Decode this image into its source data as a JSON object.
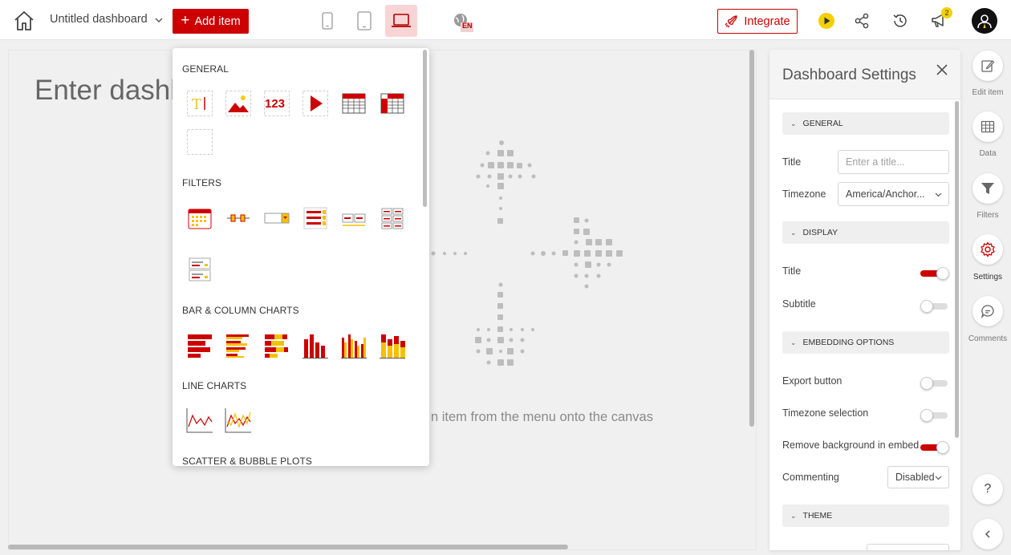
{
  "topbar": {
    "dashboard_name": "Untitled dashboard",
    "add_item_label": "Add item",
    "integrate_label": "Integrate",
    "language_code": "EN",
    "notification_count": "2",
    "accent_color": "#cc0000"
  },
  "canvas": {
    "title_placeholder": "Enter dashb",
    "hint": "n item from the menu onto the canvas"
  },
  "add_menu": {
    "sections": [
      {
        "title": "GENERAL",
        "items": [
          "text-item-icon",
          "image-item-icon",
          "number-item-icon",
          "video-item-icon",
          "table-item-icon",
          "pivot-table-item-icon",
          "spacer-item-icon"
        ]
      },
      {
        "title": "FILTERS",
        "items": [
          "date-filter-icon",
          "slicer-filter-icon",
          "dropdown-filter-icon",
          "checkbox-filter-icon",
          "range-filter-icon",
          "button-filter-icon",
          "multi-filter-icon"
        ]
      },
      {
        "title": "BAR & COLUMN CHARTS",
        "items": [
          "bar-chart-icon",
          "grouped-bar-chart-icon",
          "stacked-bar-chart-icon",
          "column-chart-icon",
          "grouped-column-chart-icon",
          "stacked-column-chart-icon"
        ]
      },
      {
        "title": "LINE CHARTS",
        "items": [
          "line-chart-icon",
          "multi-line-chart-icon"
        ]
      },
      {
        "title": "SCATTER & BUBBLE PLOTS",
        "items": []
      }
    ],
    "number_item_text": "123"
  },
  "settings": {
    "title": "Dashboard Settings",
    "sections": {
      "general": "GENERAL",
      "display": "DISPLAY",
      "embedding": "EMBEDDING OPTIONS",
      "theme": "THEME"
    },
    "title_label": "Title",
    "title_placeholder": "Enter a title...",
    "timezone_label": "Timezone",
    "timezone_value": "America/Anchor...",
    "display_title_label": "Title",
    "display_title_on": true,
    "subtitle_label": "Subtitle",
    "subtitle_on": false,
    "export_label": "Export button",
    "export_on": false,
    "tz_selection_label": "Timezone selection",
    "tz_selection_on": false,
    "remove_bg_label": "Remove background in embed",
    "remove_bg_on": true,
    "commenting_label": "Commenting",
    "commenting_value": "Disabled"
  },
  "rail": {
    "edit_item": "Edit item",
    "data": "Data",
    "filters": "Filters",
    "settings": "Settings",
    "comments": "Comments",
    "help": "?"
  }
}
